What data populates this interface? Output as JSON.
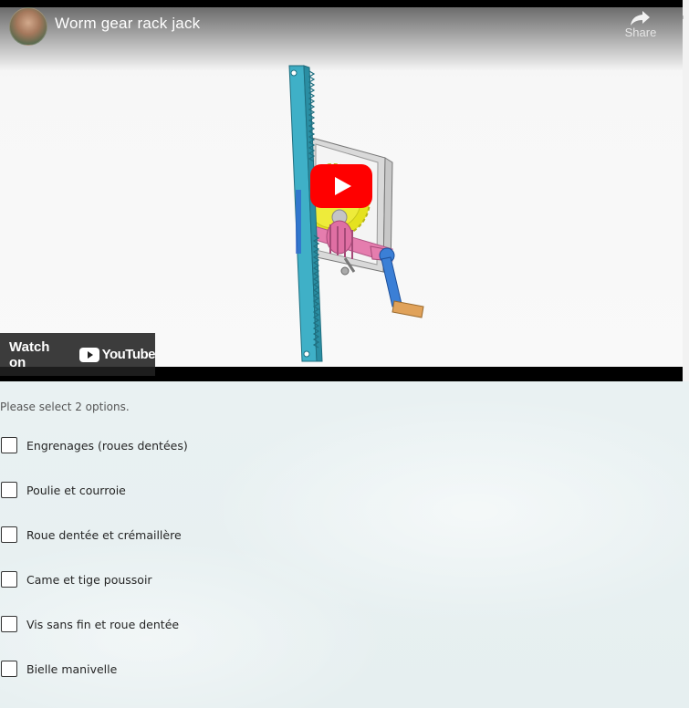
{
  "video": {
    "title": "Worm gear rack jack",
    "share_label": "Share",
    "watch_on_label": "Watch on",
    "youtube_word": "YouTube",
    "icons": {
      "avatar": "channel-avatar",
      "share": "share-icon",
      "play": "play-button-icon",
      "youtube": "youtube-logo-icon"
    },
    "colors": {
      "play_red": "#ff0000",
      "rack": "#3fb0c7",
      "gear": "#e5e21f",
      "worm": "#e57dae",
      "crank": "#3b7fd6",
      "handle": "#e0a25a"
    }
  },
  "form": {
    "instruction": "Please select 2 options.",
    "options": [
      {
        "label": "Engrenages (roues dentées)",
        "checked": false
      },
      {
        "label": "Poulie et courroie",
        "checked": false
      },
      {
        "label": "Roue dentée et crémaillère",
        "checked": false
      },
      {
        "label": "Came et tige poussoir",
        "checked": false
      },
      {
        "label": "Vis sans fin et roue dentée",
        "checked": false
      },
      {
        "label": "Bielle manivelle",
        "checked": false
      }
    ]
  }
}
